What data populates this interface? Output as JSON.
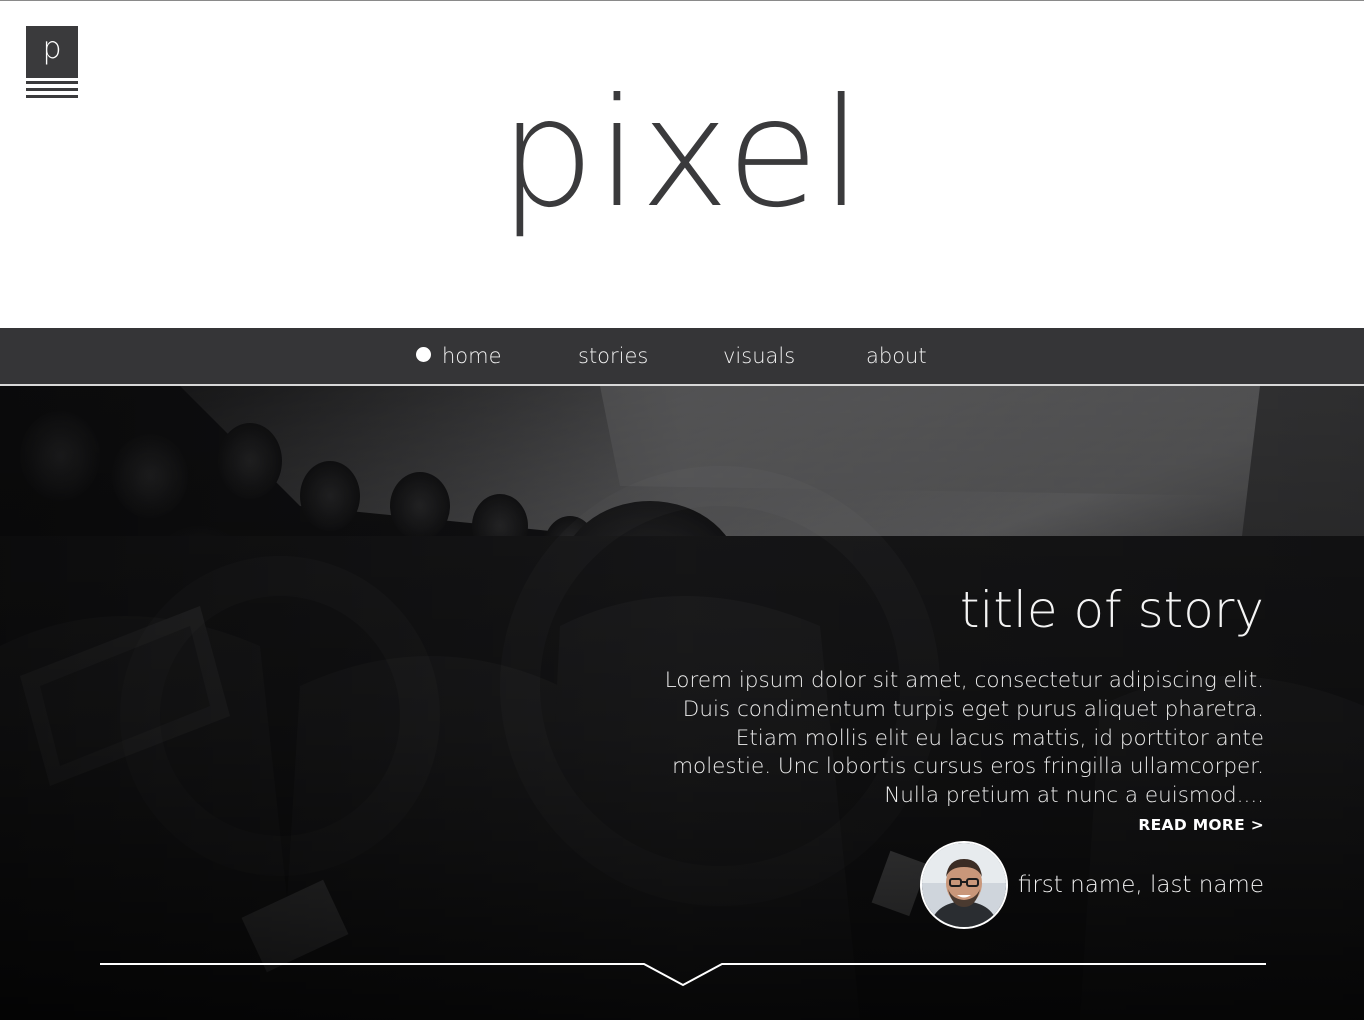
{
  "logo": {
    "letter": "p"
  },
  "site": {
    "title": "pixel"
  },
  "nav": {
    "items": [
      {
        "label": "home",
        "active": true
      },
      {
        "label": "stories",
        "active": false
      },
      {
        "label": "visuals",
        "active": false
      },
      {
        "label": "about",
        "active": false
      }
    ]
  },
  "story": {
    "title": "title of story",
    "excerpt": "Lorem ipsum dolor sit amet, consectetur adipiscing elit. Duis condimentum turpis eget purus aliquet pharetra. Etiam mollis elit eu lacus mattis, id porttitor ante molestie. Unc lobortis cursus eros fringilla ullamcorper. Nulla pretium at nunc a euismod....",
    "read_more": "READ MORE >",
    "author": {
      "name": "first name, last name"
    }
  },
  "colors": {
    "text_dark": "#3a3a3c",
    "nav_background": "#353537",
    "hero_text": "#f4f4f4"
  },
  "icons": {
    "active_nav": "filled-circle-icon",
    "scroll_down": "chevron-down-icon"
  }
}
